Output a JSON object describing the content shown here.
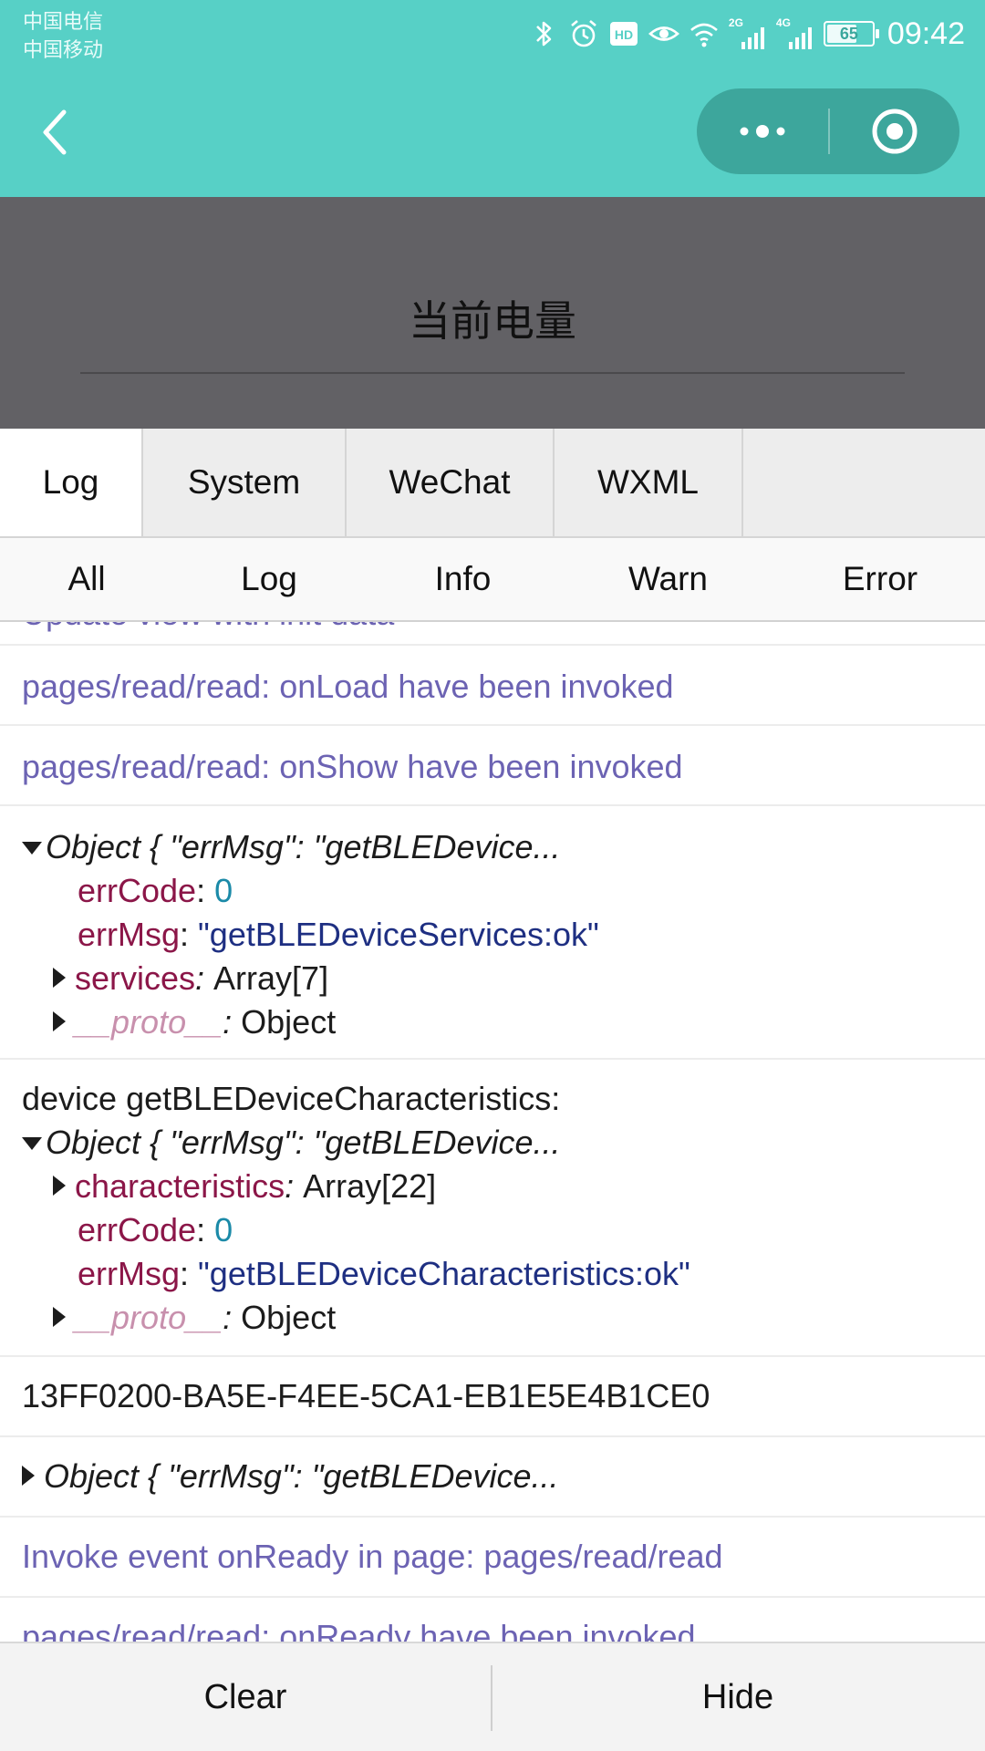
{
  "status_bar": {
    "carrier_1": "中国电信",
    "carrier_2": "中国移动",
    "hd_badge": "HD",
    "net_2g": "2G",
    "net_4g": "4G",
    "battery": "65",
    "time": "09:42",
    "icons": [
      "bluetooth-icon",
      "alarm-icon",
      "hd-icon",
      "eye-icon",
      "wifi-icon",
      "signal-2g-icon",
      "signal-4g-icon",
      "battery-icon"
    ]
  },
  "nav": {
    "back_icon": "chevron-left-icon",
    "more_icon": "more-dots-icon",
    "close_icon": "target-close-icon"
  },
  "page": {
    "title": "当前电量"
  },
  "console": {
    "tabs": [
      {
        "label": "Log",
        "active": true
      },
      {
        "label": "System",
        "active": false
      },
      {
        "label": "WeChat",
        "active": false
      },
      {
        "label": "WXML",
        "active": false
      }
    ],
    "filters": [
      {
        "label": "All"
      },
      {
        "label": "Log"
      },
      {
        "label": "Info"
      },
      {
        "label": "Warn"
      },
      {
        "label": "Error"
      }
    ],
    "logs": {
      "partial_top": "Update view with init data",
      "onload": "pages/read/read: onLoad have been invoked",
      "onshow": "pages/read/read: onShow have been invoked",
      "obj1": {
        "summary": "Object { \"errMsg\": \"getBLEDevice...",
        "errcode_key": "errCode",
        "errcode_val": "0",
        "errmsg_key": "errMsg",
        "errmsg_val": "\"getBLEDeviceServices:ok\"",
        "services_key": "services",
        "services_val": "Array[7]",
        "proto_key": "__proto__",
        "proto_val": "Object"
      },
      "device_label": "device getBLEDeviceCharacteristics:",
      "obj2": {
        "summary": "Object { \"errMsg\": \"getBLEDevice...",
        "chars_key": "characteristics",
        "chars_val": "Array[22]",
        "errcode_key": "errCode",
        "errcode_val": "0",
        "errmsg_key": "errMsg",
        "errmsg_val": "\"getBLEDeviceCharacteristics:ok\"",
        "proto_key": "__proto__",
        "proto_val": "Object"
      },
      "uuid": "13FF0200-BA5E-F4EE-5CA1-EB1E5E4B1CE0",
      "obj3_summary": "Object { \"errMsg\": \"getBLEDevice...",
      "onready": "Invoke event onReady in page: pages/read/read",
      "partial_bottom": "pages/read/read: onReady have been invoked"
    },
    "clear_label": "Clear",
    "hide_label": "Hide"
  }
}
